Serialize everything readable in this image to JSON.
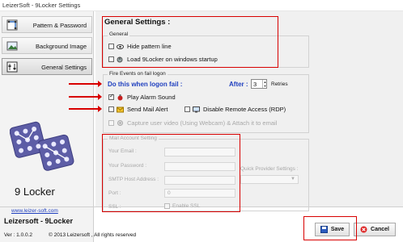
{
  "window": {
    "title": "LeizerSoft - 9Locker Settings"
  },
  "sidebar": {
    "items": [
      {
        "label": "Pattern & Password",
        "icon": "pattern-icon"
      },
      {
        "label": "Background Image",
        "icon": "image-icon"
      },
      {
        "label": "General Settings",
        "icon": "settings-icon"
      }
    ],
    "logo_text": "9 Locker",
    "website": "www.leizer-soft.com",
    "brand": "Leizersoft - 9Locker",
    "version": "Ver :  1.0.0.2",
    "copyright": "© 2013 Leizersoft , All rights reserved"
  },
  "main": {
    "heading": "General Settings :",
    "general": {
      "group_label": "General",
      "hide_pattern": "Hide pattern line",
      "load_startup": "Load 9Locker on windows startup"
    },
    "fire": {
      "group_label": "Fire Events on fail logon",
      "do_this": "Do this when logon fail :",
      "after_label": "After :",
      "retries_value": "3",
      "retries_label": "Retries",
      "play_alarm": "Play Alarm Sound",
      "send_mail": "Send Mail Alert",
      "disable_remote": "Disable Remote Access (RDP)",
      "capture_video": "Capture user video (Using Webcam) & Attach it to email"
    },
    "mail": {
      "group_label": "Mail Account Setting",
      "email_label": "Your Email :",
      "password_label": "Your Password :",
      "smtp_label": "SMTP Host Address :",
      "port_label": "Port :",
      "port_value": "0",
      "ssl_label": "SSL :",
      "enable_ssl": "Enable SSL",
      "quick_provider": "Quick Provider Settings :"
    },
    "buttons": {
      "save": "Save",
      "cancel": "Cancel"
    }
  },
  "colors": {
    "accent_blue": "#1f3fbf",
    "annotation_red": "#d80000"
  }
}
